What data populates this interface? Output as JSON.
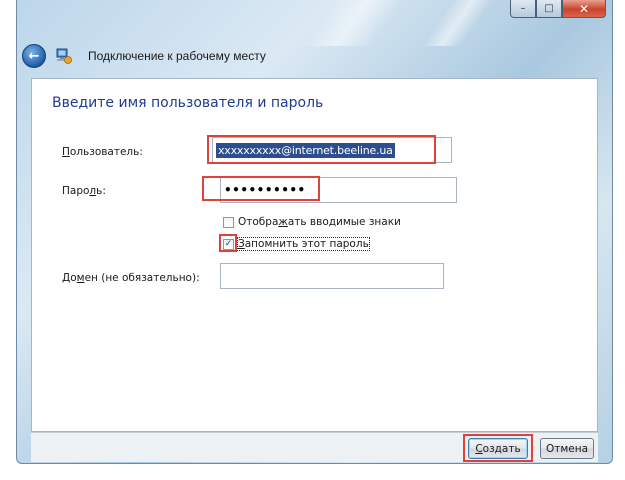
{
  "window": {
    "title": "Подключение к рабочему месту",
    "caption_buttons": {
      "minimize": "–",
      "maximize": "□",
      "close": "✕"
    }
  },
  "form": {
    "heading": "Введите имя пользователя и пароль",
    "user_label_accel": "П",
    "user_label_rest": "ользователь:",
    "username_value": "xxxxxxxxxx@internet.beeline.ua",
    "password_label_before": "Паро",
    "password_label_accel": "л",
    "password_label_after": "ь:",
    "password_value": "••••••••••",
    "show_chars_before": "Отобра",
    "show_chars_accel": "ж",
    "show_chars_after": "ать вводимые знаки",
    "show_chars_checked": false,
    "remember_accel": "З",
    "remember_rest": "апомнить этот пароль",
    "remember_checked": true,
    "domain_label_before": "До",
    "domain_label_accel": "м",
    "domain_label_after": "ен (не обязательно):",
    "domain_value": ""
  },
  "footer": {
    "create_label_accel": "С",
    "create_label_rest": "оздать",
    "cancel_label": "Отмена"
  },
  "colors": {
    "heading": "#1e3d8f",
    "highlight": "#e0413a",
    "selection": "#2d4e8e"
  },
  "icons": {
    "back": "back-arrow-icon",
    "app": "network-connection-icon"
  }
}
